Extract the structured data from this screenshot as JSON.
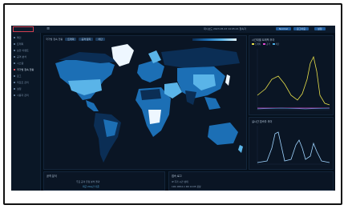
{
  "app": {
    "menu_icon": "≡",
    "top_info": "대시보드  2023.05.23 14:05:21  접속자",
    "status": "Normal",
    "buttons": [
      "로그아웃",
      "설정"
    ]
  },
  "sidebar": {
    "items": [
      {
        "label": "메인"
      },
      {
        "label": "트래픽"
      },
      {
        "label": "보안 이벤트"
      },
      {
        "label": "공격 분석"
      },
      {
        "label": "시스템"
      },
      {
        "label": "국가별 접속 현황"
      },
      {
        "label": "로그"
      },
      {
        "label": "리포트 관리"
      },
      {
        "label": "설정"
      },
      {
        "label": "사용자 관리"
      }
    ]
  },
  "map": {
    "title": "국가별 접속 현황",
    "chips": [
      "트래픽",
      "공격 탐지",
      "차단"
    ]
  },
  "panel_line1": {
    "title": "시간대별 트래픽 추이",
    "legend": [
      {
        "label": "트래픽",
        "color": "#e8e04a"
      },
      {
        "label": "공격",
        "color": "#e04ad0"
      },
      {
        "label": "차단",
        "color": "#4ab0e8"
      }
    ]
  },
  "panel_line2": {
    "title": "실시간 접속자 추이"
  },
  "panel_bottom_left": {
    "title": "공격 분석",
    "lines": [
      "주요 공격 유형 분석 결과",
      "최근 24시간 기준"
    ]
  },
  "panel_bottom_right": {
    "title": "접속 로그",
    "rows": [
      "IP  국가  시간  상태",
      "192.168.0.1  KR  14:05  정상"
    ]
  },
  "colors": {
    "background": "#05101c",
    "panel": "#0a1524",
    "map_dark": "#0b2e55",
    "map_mid": "#1c6fb5",
    "map_light": "#5ab4e8",
    "map_white": "#eef7ff"
  }
}
